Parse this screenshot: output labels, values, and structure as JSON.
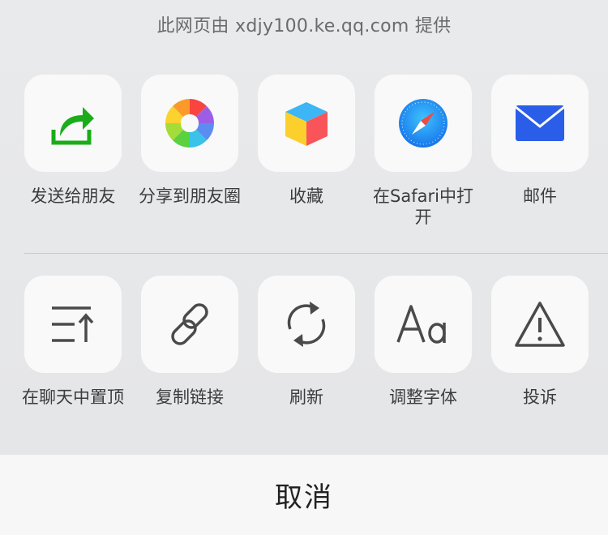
{
  "header": {
    "source_text": "此网页由 xdjy100.ke.qq.com 提供"
  },
  "row1": [
    {
      "label": "发送给朋友",
      "icon": "send-to-friend-icon"
    },
    {
      "label": "分享到朋友圈",
      "icon": "moments-icon"
    },
    {
      "label": "收藏",
      "icon": "favorites-cube-icon"
    },
    {
      "label": "在Safari中打开",
      "icon": "safari-compass-icon"
    },
    {
      "label": "邮件",
      "icon": "mail-envelope-icon"
    }
  ],
  "row2": [
    {
      "label": "在聊天中置顶",
      "icon": "pin-to-top-icon"
    },
    {
      "label": "复制链接",
      "icon": "link-icon"
    },
    {
      "label": "刷新",
      "icon": "refresh-icon"
    },
    {
      "label": "调整字体",
      "icon": "font-size-icon"
    },
    {
      "label": "投诉",
      "icon": "warning-icon"
    }
  ],
  "footer": {
    "cancel_label": "取消"
  },
  "colors": {
    "send_green": "#1aad19",
    "mail_blue": "#2a5ee8",
    "safari_blue": "#1e8ef5",
    "icon_gray": "#4a4a4a"
  }
}
